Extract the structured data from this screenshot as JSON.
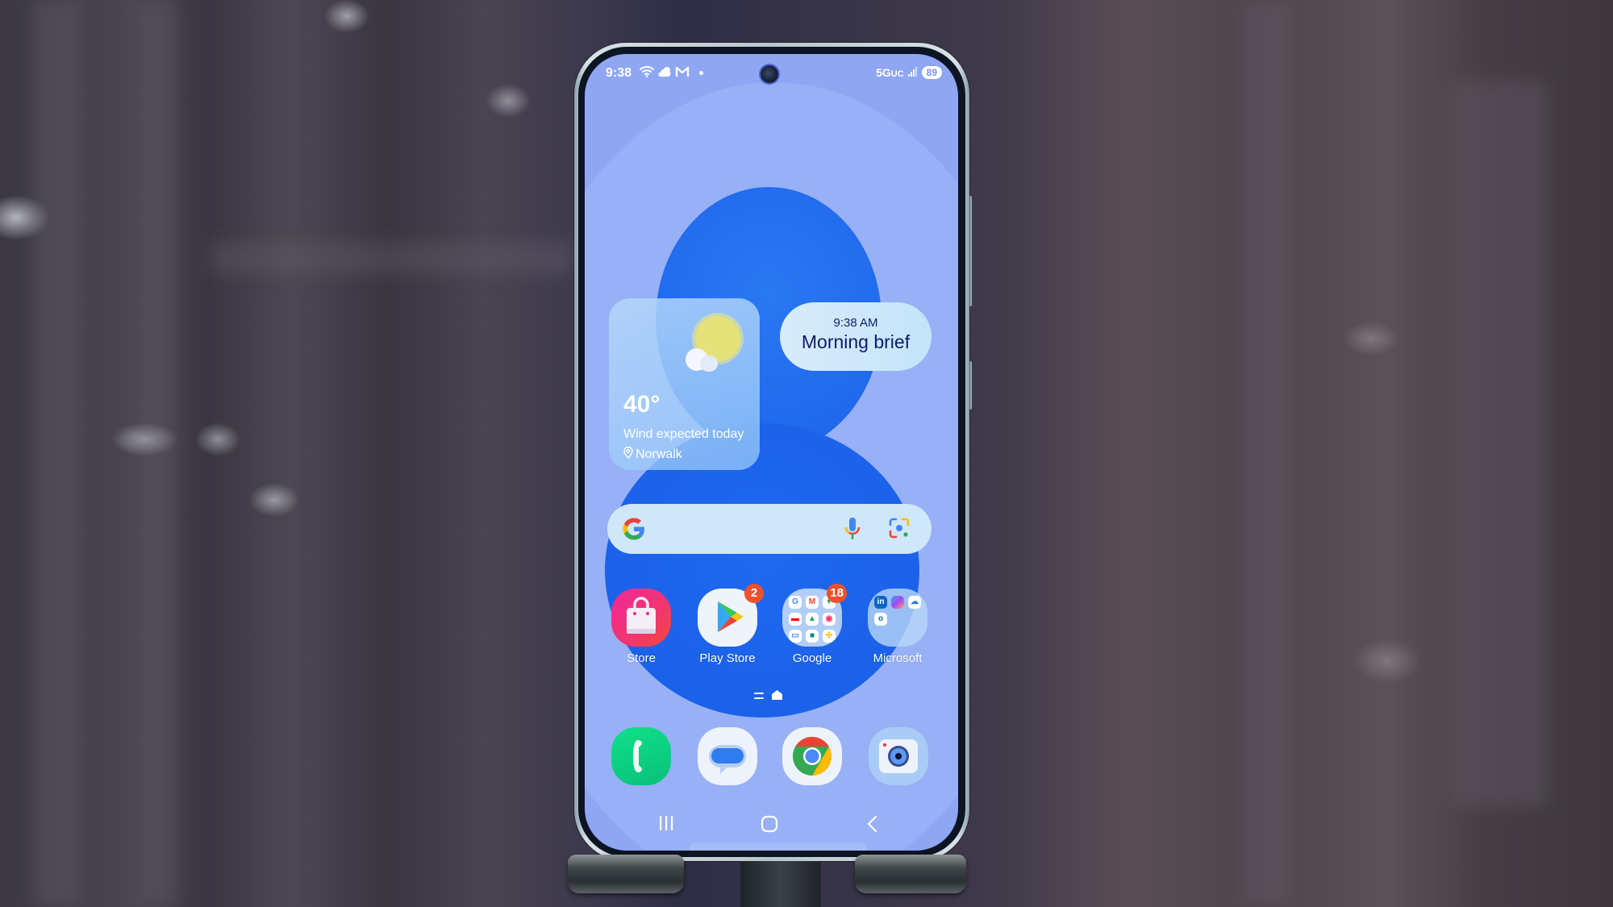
{
  "status_bar": {
    "time": "9:38",
    "left_icons": [
      "wifi-icon",
      "weather-cloud-icon",
      "gmail-icon",
      "notification-dot-icon"
    ],
    "network": "5G",
    "network_suffix": "UC",
    "battery": "89"
  },
  "weather_widget": {
    "temperature": "40°",
    "description": "Wind expected today",
    "location": "Norwalk",
    "icon": "partly-cloudy-icon"
  },
  "brief_widget": {
    "time": "9:38 AM",
    "title": "Morning brief"
  },
  "search_bar": {
    "icons": [
      "google-g-icon",
      "microphone-icon",
      "google-lens-icon"
    ]
  },
  "apps": [
    {
      "label": "Store",
      "icon": "galaxy-store-icon",
      "badge": null
    },
    {
      "label": "Play Store",
      "icon": "play-store-icon",
      "badge": "2"
    },
    {
      "label": "Google",
      "icon": "google-folder-icon",
      "badge": "18"
    },
    {
      "label": "Microsoft",
      "icon": "microsoft-folder-icon",
      "badge": null
    }
  ],
  "google_folder_items": [
    "G",
    "M",
    "Maps",
    "YouTube",
    "Drive",
    "Music",
    "TV",
    "Meet",
    "Photos"
  ],
  "microsoft_folder_items": [
    "in",
    "Copilot",
    "OneDrive",
    "Outlook"
  ],
  "dock": [
    {
      "icon": "phone-icon",
      "label": "Phone"
    },
    {
      "icon": "messages-icon",
      "label": "Messages"
    },
    {
      "icon": "chrome-icon",
      "label": "Chrome"
    },
    {
      "icon": "camera-icon",
      "label": "Camera"
    }
  ],
  "nav_bar": [
    "recents-button",
    "home-button",
    "back-button"
  ],
  "colors": {
    "wallpaper_light": "#8fa6f2",
    "wallpaper_dark": "#1f68f0",
    "badge": "#f0502c",
    "brief_text": "#0e1c6a"
  }
}
